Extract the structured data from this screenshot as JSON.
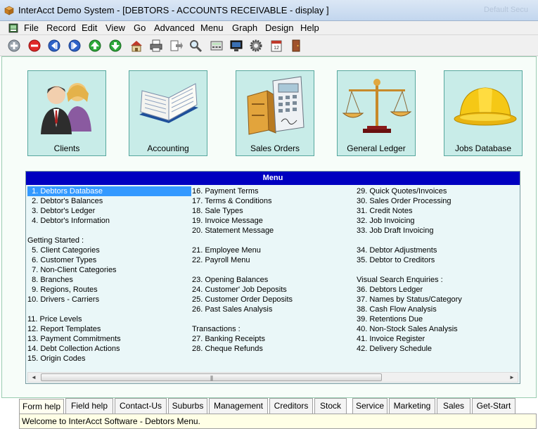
{
  "window": {
    "title": "InterAcct Demo System - [DEBTORS - ACCOUNTS RECEIVABLE - display ]",
    "ghost_text": "Default Secu"
  },
  "menubar": [
    "File",
    "Record",
    "Edit",
    "View",
    "Go",
    "Advanced",
    "Menu",
    "Graph",
    "Design",
    "Help"
  ],
  "toolbar": [
    "add-icon",
    "delete-icon",
    "previous-icon",
    "next-icon",
    "up-icon",
    "down-icon",
    "home-icon",
    "print-icon",
    "export-icon",
    "search-icon",
    "calculator-icon",
    "monitor-icon",
    "settings-icon",
    "calendar-icon",
    "exit-door-icon"
  ],
  "tiles": [
    {
      "label": "Clients",
      "icon": "people-icon"
    },
    {
      "label": "Accounting",
      "icon": "open-book-icon"
    },
    {
      "label": "Sales Orders",
      "icon": "cash-register-icon"
    },
    {
      "label": "General Ledger",
      "icon": "scales-icon"
    },
    {
      "label": "Jobs Database",
      "icon": "hard-hat-icon"
    }
  ],
  "menu": {
    "header": "Menu",
    "columns": [
      [
        {
          "text": "  1. Debtors Database",
          "selected": true
        },
        {
          "text": "  2. Debtor's Balances"
        },
        {
          "text": "  3. Debtor's Ledger"
        },
        {
          "text": "  4. Debtor's Information"
        },
        {
          "text": ""
        },
        {
          "text": "Getting Started :",
          "heading": true
        },
        {
          "text": "  5. Client Categories"
        },
        {
          "text": "  6. Customer Types"
        },
        {
          "text": "  7. Non-Client Categories"
        },
        {
          "text": "  8. Branches"
        },
        {
          "text": "  9. Regions, Routes"
        },
        {
          "text": "10. Drivers - Carriers"
        },
        {
          "text": ""
        },
        {
          "text": "11. Price Levels"
        },
        {
          "text": "12. Report Templates"
        },
        {
          "text": "13. Payment Commitments"
        },
        {
          "text": "14. Debt Collection Actions"
        },
        {
          "text": "15. Origin Codes"
        }
      ],
      [
        {
          "text": "16. Payment Terms"
        },
        {
          "text": "17. Terms & Conditions"
        },
        {
          "text": "18. Sale Types"
        },
        {
          "text": "19. Invoice Message"
        },
        {
          "text": "20. Statement Message"
        },
        {
          "text": ""
        },
        {
          "text": "21. Employee Menu"
        },
        {
          "text": "22. Payroll Menu"
        },
        {
          "text": ""
        },
        {
          "text": "23. Opening Balances"
        },
        {
          "text": "24. Customer' Job Deposits"
        },
        {
          "text": "25. Customer Order Deposits"
        },
        {
          "text": "26. Past Sales Analysis"
        },
        {
          "text": ""
        },
        {
          "text": "Transactions :",
          "heading": true
        },
        {
          "text": "27. Banking Receipts"
        },
        {
          "text": "28. Cheque Refunds"
        }
      ],
      [
        {
          "text": "29. Quick Quotes/Invoices"
        },
        {
          "text": "30. Sales Order Processing"
        },
        {
          "text": "31. Credit Notes"
        },
        {
          "text": "32. Job Invoicing"
        },
        {
          "text": "33. Job Draft Invoicing"
        },
        {
          "text": ""
        },
        {
          "text": "34. Debtor Adjustments"
        },
        {
          "text": "35. Debtor to Creditors"
        },
        {
          "text": ""
        },
        {
          "text": "Visual Search Enquiries :",
          "heading": true
        },
        {
          "text": "36. Debtors Ledger"
        },
        {
          "text": "37. Names by Status/Category"
        },
        {
          "text": "38. Cash Flow Analysis"
        },
        {
          "text": "39. Retentions Due"
        },
        {
          "text": "40. Non-Stock Sales Analysis"
        },
        {
          "text": "41. Invoice Register"
        },
        {
          "text": "42. Delivery Schedule"
        }
      ]
    ]
  },
  "scroll": {
    "left": "◄",
    "right": "►",
    "grip": "|||"
  },
  "tabs": [
    {
      "label": "Form help",
      "active": true
    },
    {
      "label": "Field help"
    },
    {
      "label": "Contact-Us"
    },
    {
      "label": "Suburbs"
    },
    {
      "label": "Management"
    },
    {
      "label": "Creditors"
    },
    {
      "label": "Stock"
    },
    {
      "label": "Service"
    },
    {
      "label": "Marketing"
    },
    {
      "label": "Sales"
    },
    {
      "label": "Get-Start"
    }
  ],
  "status": "Welcome to InterAcct Software - Debtors Menu."
}
